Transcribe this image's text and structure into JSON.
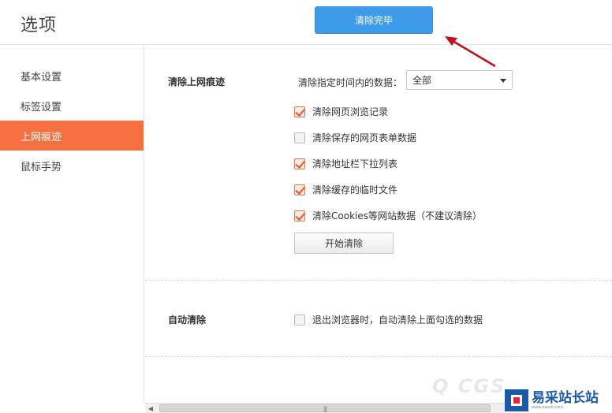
{
  "header": {
    "title": "选项",
    "done_button": "清除完毕"
  },
  "sidebar": {
    "items": [
      {
        "label": "基本设置",
        "active": false
      },
      {
        "label": "标签设置",
        "active": false
      },
      {
        "label": "上网痕迹",
        "active": true
      },
      {
        "label": "鼠标手势",
        "active": false
      }
    ]
  },
  "clear_history": {
    "title": "清除上网痕迹",
    "time_range_label": "清除指定时间内的数据：",
    "time_range_value": "全部",
    "options": [
      {
        "label": "清除网页浏览记录",
        "checked": true
      },
      {
        "label": "清除保存的网页表单数据",
        "checked": false
      },
      {
        "label": "清除地址栏下拉列表",
        "checked": true
      },
      {
        "label": "清除缓存的临时文件",
        "checked": true
      },
      {
        "label": "清除Cookies等网站数据（不建议清除）",
        "checked": true
      }
    ],
    "start_button": "开始清除"
  },
  "auto_clear": {
    "title": "自动清除",
    "option": {
      "label": "退出浏览器时，自动清除上面勾选的数据",
      "checked": false
    }
  },
  "watermark": {
    "text": "易采站长站",
    "sub": "www.easck.com",
    "faint": "Q CGS"
  },
  "colors": {
    "accent_blue": "#3d9be9",
    "active_orange": "#f7703f",
    "check_red": "#e8562a",
    "arrow_red": "#c0121c"
  },
  "icons": {
    "arrow": "red-arrow-icon",
    "checkmark": "check-icon",
    "dropdown": "caret-down-icon"
  }
}
